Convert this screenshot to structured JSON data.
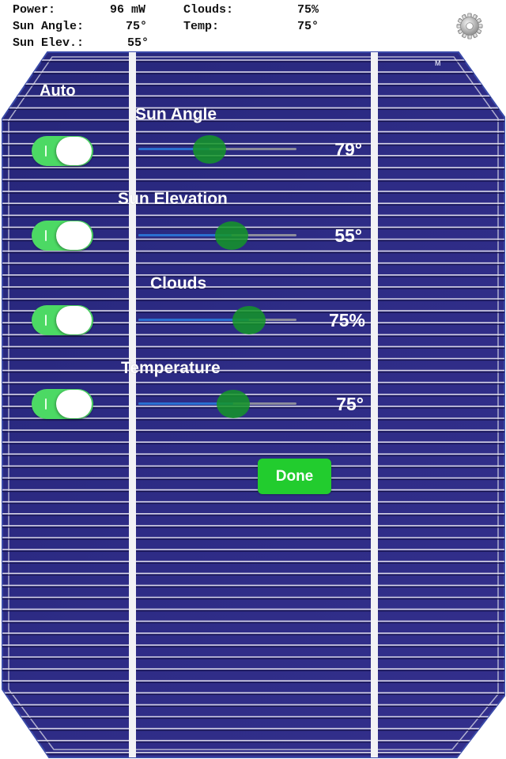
{
  "readout": {
    "power_label": "Power:",
    "power_value": "96 mW",
    "clouds_label": "Clouds:",
    "clouds_value": "75%",
    "sun_angle_label": "Sun Angle:",
    "sun_angle_value": "75°",
    "temp_label": "Temp:",
    "temp_value": "75°",
    "sun_elev_label": "Sun Elev.:",
    "sun_elev_value": "55°"
  },
  "header": {
    "settings_icon": "gear-icon"
  },
  "panel": {
    "auto_label": "Auto",
    "cell_mark": "M",
    "controls": [
      {
        "label": "Sun Angle",
        "value": "79°",
        "auto_on": true,
        "slider_fraction": 0.45
      },
      {
        "label": "Sun Elevation",
        "value": "55°",
        "auto_on": true,
        "slider_fraction": 0.59
      },
      {
        "label": "Clouds",
        "value": "75%",
        "auto_on": true,
        "slider_fraction": 0.7
      },
      {
        "label": "Temperature",
        "value": "75°",
        "auto_on": true,
        "slider_fraction": 0.6
      }
    ],
    "done_label": "Done"
  },
  "colors": {
    "cell_blue": "#2a2a7e",
    "toggle_on": "#4cd964",
    "slider_fill": "#2a6fd0",
    "slider_thumb": "#149628",
    "done_button": "#22cc2e"
  }
}
